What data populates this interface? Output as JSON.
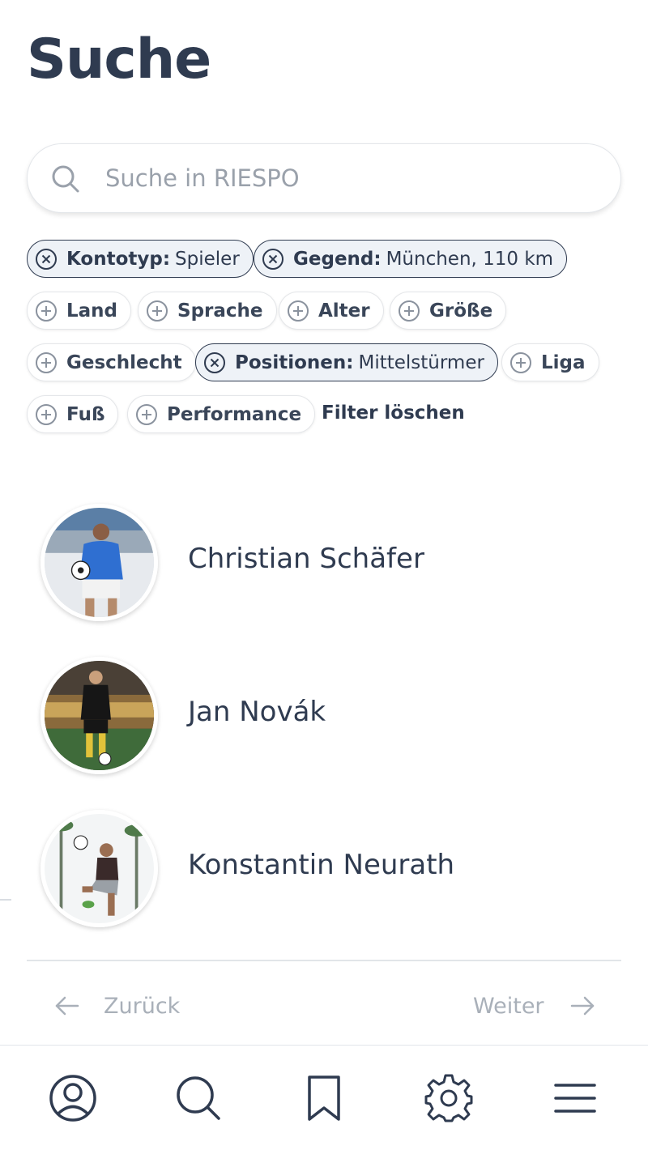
{
  "page": {
    "title": "Suche"
  },
  "search": {
    "placeholder": "Suche in RIESPO",
    "value": ""
  },
  "filters": {
    "kontotyp": {
      "key": "Kontotyp:",
      "value": "Spieler"
    },
    "gegend": {
      "key": "Gegend:",
      "value": "München, 110 km"
    },
    "land": {
      "key": "Land"
    },
    "sprache": {
      "key": "Sprache"
    },
    "alter": {
      "key": "Alter"
    },
    "groesse": {
      "key": "Größe"
    },
    "geschlecht": {
      "key": "Geschlecht"
    },
    "positionen": {
      "key": "Positionen:",
      "value": "Mittelstürmer"
    },
    "liga": {
      "key": "Liga"
    },
    "fuss": {
      "key": "Fuß"
    },
    "performance": {
      "key": "Performance"
    },
    "clear_label": "Filter löschen"
  },
  "results": [
    {
      "name": "Christian Schäfer"
    },
    {
      "name": "Jan Novák"
    },
    {
      "name": "Konstantin Neurath"
    }
  ],
  "pagination": {
    "prev_label": "Zurück",
    "next_label": "Weiter"
  },
  "bottom_nav": {
    "items": [
      {
        "icon": "profile-icon"
      },
      {
        "icon": "search-icon"
      },
      {
        "icon": "bookmark-icon"
      },
      {
        "icon": "gear-icon"
      },
      {
        "icon": "menu-icon"
      }
    ]
  },
  "colors": {
    "text": "#2f3b50",
    "muted": "#9aa1ab",
    "active_chip_bg": "#eef2f7",
    "border": "#e2e5e9"
  }
}
